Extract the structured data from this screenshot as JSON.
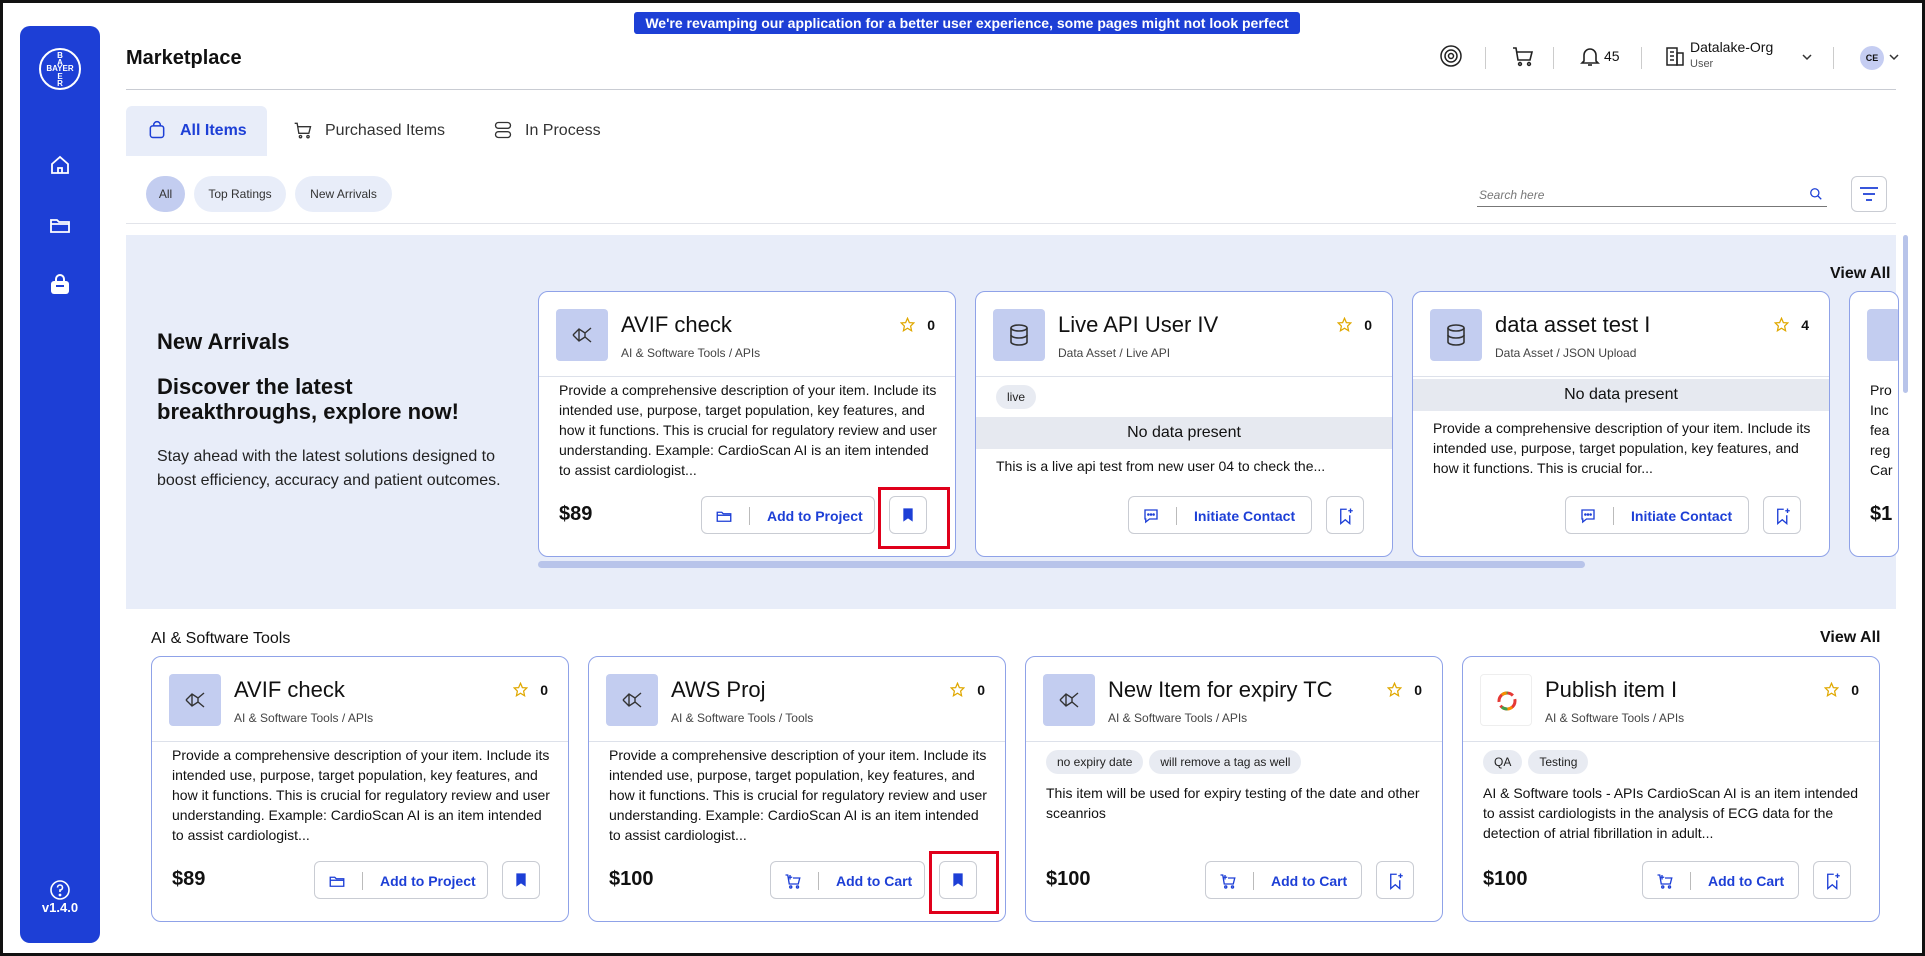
{
  "banner": "We're revamping our application for a better user experience, some pages might not look perfect yet!",
  "sidebar": {
    "logo_h": "BAYER",
    "logo_v": [
      "B",
      "A",
      "Y",
      "E",
      "R"
    ],
    "version": "v1.4.0"
  },
  "header": {
    "title": "Marketplace",
    "notifications_count": "45",
    "org_name": "Datalake-Org",
    "org_role": "User",
    "avatar_initials": "CE"
  },
  "tabs": [
    {
      "label": "All Items"
    },
    {
      "label": "Purchased Items"
    },
    {
      "label": "In Process"
    }
  ],
  "filters": {
    "chips": [
      "All",
      "Top Ratings",
      "New Arrivals"
    ],
    "search_placeholder": "Search here"
  },
  "new_arrivals": {
    "title": "New Arrivals",
    "headline": "Discover the latest breakthroughs, explore now!",
    "text": "Stay ahead with the latest solutions designed to boost efficiency, accuracy and patient outcomes.",
    "view_all": "View All",
    "cards": [
      {
        "title": "AVIF check",
        "category": "AI & Software Tools / APIs",
        "rating": "0",
        "description": "Provide a comprehensive description of your item. Include its intended use, purpose, target population, key features, and how it functions. This is crucial for regulatory review and user understanding. Example: CardioScan AI is an item intended to assist cardiologist...",
        "price": "$89",
        "action": "Add to Project"
      },
      {
        "title": "Live API User IV",
        "category": "Data Asset / Live API",
        "rating": "0",
        "tags": [
          "live"
        ],
        "nodata": "No data present",
        "description": "This is a live api test from new user 04 to check the...",
        "action": "Initiate Contact"
      },
      {
        "title": "data asset test I",
        "category": "Data Asset / JSON Upload",
        "rating": "4",
        "nodata": "No data present",
        "description": "Provide a comprehensive description of your item. Include its intended use, purpose, target population, key features, and how it functions. This is crucial for...",
        "action": "Initiate Contact"
      },
      {
        "description_peek": "Pro Inc fea reg Car",
        "price_peek": "$1"
      }
    ]
  },
  "ai_tools": {
    "title": "AI & Software Tools",
    "view_all": "View All",
    "cards": [
      {
        "title": "AVIF check",
        "category": "AI & Software Tools / APIs",
        "rating": "0",
        "description": "Provide a comprehensive description of your item. Include its intended use, purpose, target population, key features, and how it functions. This is crucial for regulatory review and user understanding. Example: CardioScan AI is an item intended to assist cardiologist...",
        "price": "$89",
        "action": "Add to Project"
      },
      {
        "title": "AWS Proj",
        "category": "AI & Software Tools / Tools",
        "rating": "0",
        "description": "Provide a comprehensive description of your item. Include its intended use, purpose, target population, key features, and how it functions. This is crucial for regulatory review and user understanding. Example: CardioScan AI is an item intended to assist cardiologist...",
        "price": "$100",
        "action": "Add to Cart"
      },
      {
        "title": "New Item for expiry TC",
        "category": "AI & Software Tools / APIs",
        "rating": "0",
        "tags": [
          "no expiry date",
          "will remove a tag as well"
        ],
        "description": "This item will be used for expiry testing of the date and other sceanrios",
        "price": "$100",
        "action": "Add to Cart"
      },
      {
        "title": "Publish item I",
        "category": "AI & Software Tools / APIs",
        "rating": "0",
        "tags": [
          "QA",
          "Testing"
        ],
        "description": "AI & Software tools - APIs CardioScan AI is an item intended to assist cardiologists in the analysis of ECG data for the detection of atrial fibrillation in adult...",
        "price": "$100",
        "action": "Add to Cart"
      }
    ]
  },
  "colors": {
    "brand": "#1d3fd6",
    "accent_light": "#e8edf9",
    "highlight": "#e0001b"
  }
}
